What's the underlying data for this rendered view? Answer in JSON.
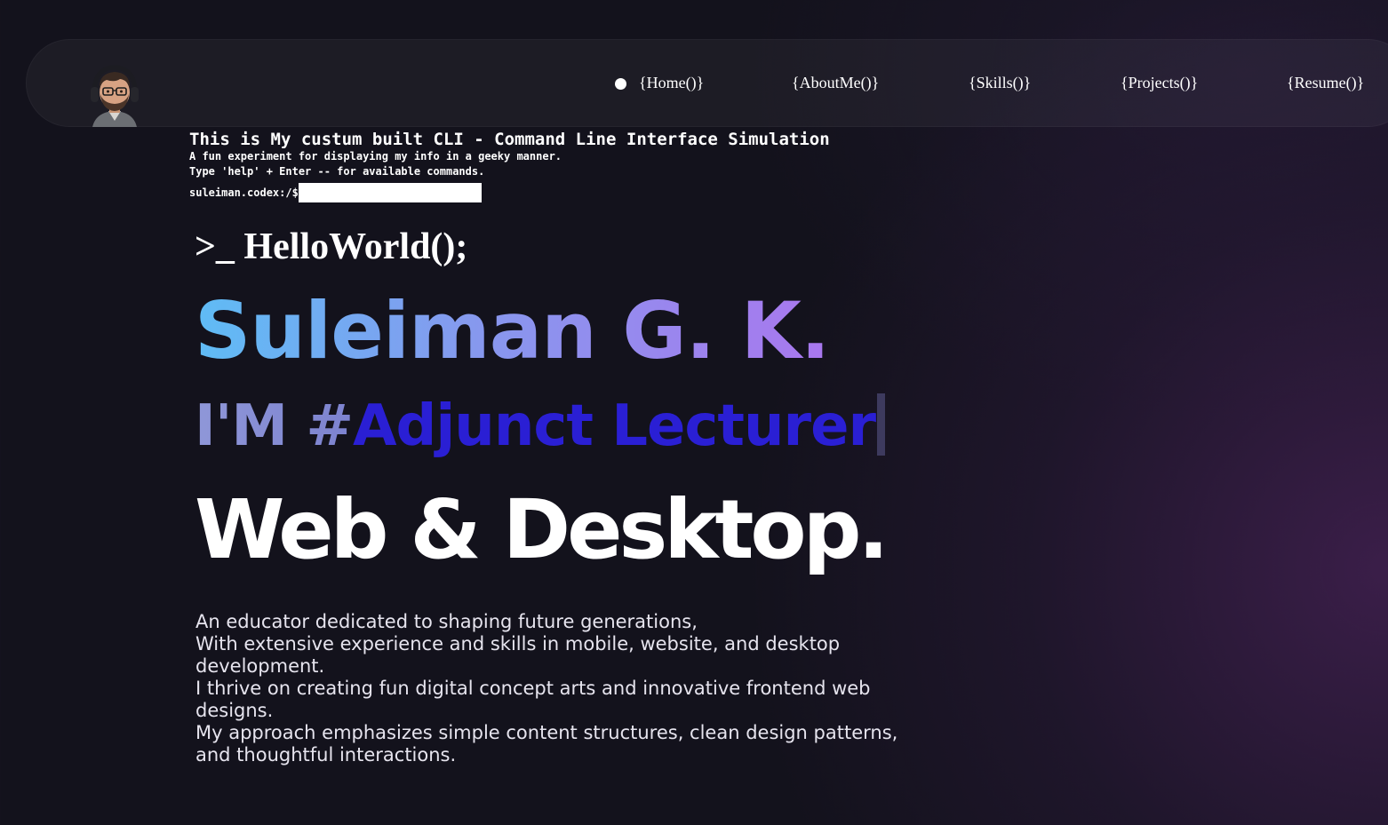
{
  "nav": {
    "links": [
      {
        "label": "{Home()}",
        "active": true
      },
      {
        "label": "{AboutMe()}",
        "active": false
      },
      {
        "label": "{Skills()}",
        "active": false
      },
      {
        "label": "{Projects()}",
        "active": false
      },
      {
        "label": "{Resume()}",
        "active": false
      }
    ]
  },
  "cli": {
    "title": "This is My custum built CLI - Command Line Interface Simulation",
    "subtitle": "A fun experiment for displaying my info in a geeky manner.",
    "help_hint": "Type 'help' + Enter -- for available commands.",
    "prompt": "suleiman.codex:/$",
    "input_value": ""
  },
  "hero": {
    "hello": ">_ HelloWorld();",
    "name": "Suleiman G. K.",
    "role_prefix": "I'M #",
    "role_text": "Adjunct Lecturer",
    "tagline": "Web & Desktop."
  },
  "bio": {
    "lines": [
      "An educator dedicated to shaping future generations,",
      "With extensive experience and skills in mobile, website, and desktop development.",
      "I thrive on creating fun digital concept arts and innovative frontend web designs.",
      "My approach emphasizes simple content structures, clean design patterns, and thoughtful interactions."
    ]
  },
  "colors": {
    "background": "#13121c",
    "accent_role": "#2a1fd4",
    "name_gradient_start": "#5fbcf5",
    "name_gradient_end": "#a977ee"
  },
  "icons": {
    "avatar": "avatar-headphones-portrait",
    "active_indicator": "dot"
  }
}
